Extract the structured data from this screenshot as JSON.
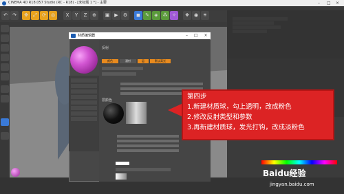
{
  "window": {
    "title": "CINEMA 4D R18.057 Studio (RC - R18) - [未标题 1 *] - 主要"
  },
  "dialog": {
    "title": "材质编辑器",
    "tabs": [
      "颜色",
      "漫射",
      "层",
      "默认高光"
    ],
    "section_reflect": "反射",
    "section_layer": "层颜色"
  },
  "annotation": {
    "lines": [
      "第四步",
      "1.新建材质球，勾上透明，改成粉色",
      "2.修改反射类型和参数",
      "3.再新建材质球，发光打钩，改成淡粉色"
    ]
  },
  "watermark": {
    "logo": "Baidu经验",
    "url": "jingyan.baidu.com"
  },
  "colors": {
    "annotation_bg": "#dc2324",
    "accent": "#e88a1e",
    "sphere": "#d255d2"
  },
  "toolbar": {
    "icons": [
      "undo-icon",
      "redo-icon",
      "move-icon",
      "scale-icon",
      "rotate-icon",
      "x-axis-icon",
      "y-axis-icon",
      "z-axis-icon",
      "coordinate-icon",
      "render-icon",
      "render-view-icon",
      "render-settings-icon",
      "cube-icon",
      "pen-icon",
      "subdivide-icon",
      "array-icon",
      "deformer-icon",
      "scene-icon",
      "camera-icon",
      "light-icon"
    ]
  }
}
